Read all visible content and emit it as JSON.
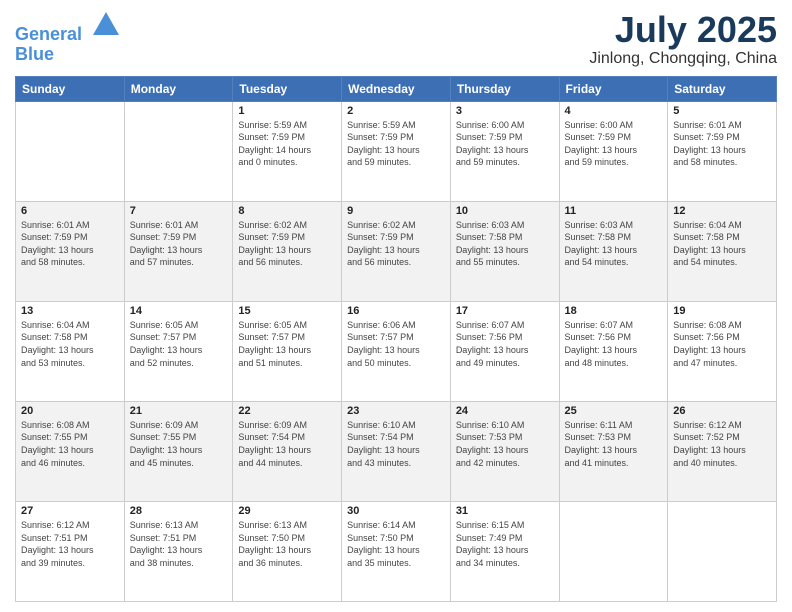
{
  "header": {
    "logo_line1": "General",
    "logo_line2": "Blue",
    "month_title": "July 2025",
    "location": "Jinlong, Chongqing, China"
  },
  "weekdays": [
    "Sunday",
    "Monday",
    "Tuesday",
    "Wednesday",
    "Thursday",
    "Friday",
    "Saturday"
  ],
  "weeks": [
    [
      {
        "day": "",
        "info": ""
      },
      {
        "day": "",
        "info": ""
      },
      {
        "day": "1",
        "info": "Sunrise: 5:59 AM\nSunset: 7:59 PM\nDaylight: 14 hours\nand 0 minutes."
      },
      {
        "day": "2",
        "info": "Sunrise: 5:59 AM\nSunset: 7:59 PM\nDaylight: 13 hours\nand 59 minutes."
      },
      {
        "day": "3",
        "info": "Sunrise: 6:00 AM\nSunset: 7:59 PM\nDaylight: 13 hours\nand 59 minutes."
      },
      {
        "day": "4",
        "info": "Sunrise: 6:00 AM\nSunset: 7:59 PM\nDaylight: 13 hours\nand 59 minutes."
      },
      {
        "day": "5",
        "info": "Sunrise: 6:01 AM\nSunset: 7:59 PM\nDaylight: 13 hours\nand 58 minutes."
      }
    ],
    [
      {
        "day": "6",
        "info": "Sunrise: 6:01 AM\nSunset: 7:59 PM\nDaylight: 13 hours\nand 58 minutes."
      },
      {
        "day": "7",
        "info": "Sunrise: 6:01 AM\nSunset: 7:59 PM\nDaylight: 13 hours\nand 57 minutes."
      },
      {
        "day": "8",
        "info": "Sunrise: 6:02 AM\nSunset: 7:59 PM\nDaylight: 13 hours\nand 56 minutes."
      },
      {
        "day": "9",
        "info": "Sunrise: 6:02 AM\nSunset: 7:59 PM\nDaylight: 13 hours\nand 56 minutes."
      },
      {
        "day": "10",
        "info": "Sunrise: 6:03 AM\nSunset: 7:58 PM\nDaylight: 13 hours\nand 55 minutes."
      },
      {
        "day": "11",
        "info": "Sunrise: 6:03 AM\nSunset: 7:58 PM\nDaylight: 13 hours\nand 54 minutes."
      },
      {
        "day": "12",
        "info": "Sunrise: 6:04 AM\nSunset: 7:58 PM\nDaylight: 13 hours\nand 54 minutes."
      }
    ],
    [
      {
        "day": "13",
        "info": "Sunrise: 6:04 AM\nSunset: 7:58 PM\nDaylight: 13 hours\nand 53 minutes."
      },
      {
        "day": "14",
        "info": "Sunrise: 6:05 AM\nSunset: 7:57 PM\nDaylight: 13 hours\nand 52 minutes."
      },
      {
        "day": "15",
        "info": "Sunrise: 6:05 AM\nSunset: 7:57 PM\nDaylight: 13 hours\nand 51 minutes."
      },
      {
        "day": "16",
        "info": "Sunrise: 6:06 AM\nSunset: 7:57 PM\nDaylight: 13 hours\nand 50 minutes."
      },
      {
        "day": "17",
        "info": "Sunrise: 6:07 AM\nSunset: 7:56 PM\nDaylight: 13 hours\nand 49 minutes."
      },
      {
        "day": "18",
        "info": "Sunrise: 6:07 AM\nSunset: 7:56 PM\nDaylight: 13 hours\nand 48 minutes."
      },
      {
        "day": "19",
        "info": "Sunrise: 6:08 AM\nSunset: 7:56 PM\nDaylight: 13 hours\nand 47 minutes."
      }
    ],
    [
      {
        "day": "20",
        "info": "Sunrise: 6:08 AM\nSunset: 7:55 PM\nDaylight: 13 hours\nand 46 minutes."
      },
      {
        "day": "21",
        "info": "Sunrise: 6:09 AM\nSunset: 7:55 PM\nDaylight: 13 hours\nand 45 minutes."
      },
      {
        "day": "22",
        "info": "Sunrise: 6:09 AM\nSunset: 7:54 PM\nDaylight: 13 hours\nand 44 minutes."
      },
      {
        "day": "23",
        "info": "Sunrise: 6:10 AM\nSunset: 7:54 PM\nDaylight: 13 hours\nand 43 minutes."
      },
      {
        "day": "24",
        "info": "Sunrise: 6:10 AM\nSunset: 7:53 PM\nDaylight: 13 hours\nand 42 minutes."
      },
      {
        "day": "25",
        "info": "Sunrise: 6:11 AM\nSunset: 7:53 PM\nDaylight: 13 hours\nand 41 minutes."
      },
      {
        "day": "26",
        "info": "Sunrise: 6:12 AM\nSunset: 7:52 PM\nDaylight: 13 hours\nand 40 minutes."
      }
    ],
    [
      {
        "day": "27",
        "info": "Sunrise: 6:12 AM\nSunset: 7:51 PM\nDaylight: 13 hours\nand 39 minutes."
      },
      {
        "day": "28",
        "info": "Sunrise: 6:13 AM\nSunset: 7:51 PM\nDaylight: 13 hours\nand 38 minutes."
      },
      {
        "day": "29",
        "info": "Sunrise: 6:13 AM\nSunset: 7:50 PM\nDaylight: 13 hours\nand 36 minutes."
      },
      {
        "day": "30",
        "info": "Sunrise: 6:14 AM\nSunset: 7:50 PM\nDaylight: 13 hours\nand 35 minutes."
      },
      {
        "day": "31",
        "info": "Sunrise: 6:15 AM\nSunset: 7:49 PM\nDaylight: 13 hours\nand 34 minutes."
      },
      {
        "day": "",
        "info": ""
      },
      {
        "day": "",
        "info": ""
      }
    ]
  ]
}
